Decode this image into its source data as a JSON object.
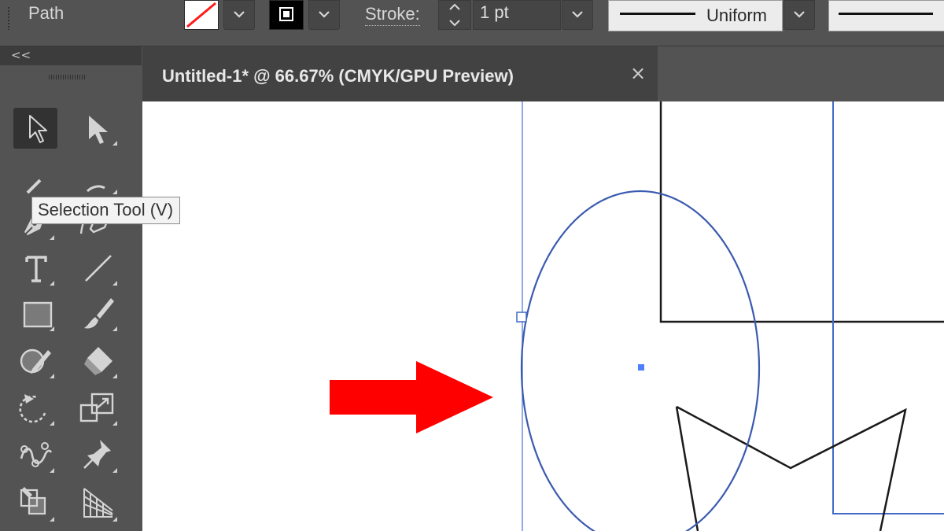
{
  "control_bar": {
    "selection_label": "Path",
    "fill_swatch_icon": "fill-none-swatch-icon",
    "stroke_swatch_icon": "stroke-black-swatch-icon",
    "stroke_label": "Stroke:",
    "stroke_weight": "1 pt",
    "variable_width_profile": "Uniform"
  },
  "toolbar": {
    "collapse_label": "<<",
    "tooltip": "Selection Tool (V)",
    "tools": [
      {
        "name": "selection-tool",
        "icon": "selection-arrow-icon",
        "active": true
      },
      {
        "name": "direct-selection-tool",
        "icon": "direct-selection-arrow-icon"
      },
      {
        "name": "magic-wand-tool",
        "icon": "magic-wand-icon"
      },
      {
        "name": "lasso-tool",
        "icon": "lasso-icon"
      },
      {
        "name": "pen-tool",
        "icon": "pen-icon"
      },
      {
        "name": "curvature-tool",
        "icon": "curvature-pen-icon"
      },
      {
        "name": "type-tool",
        "icon": "type-icon"
      },
      {
        "name": "line-segment-tool",
        "icon": "line-segment-icon"
      },
      {
        "name": "rectangle-tool",
        "icon": "rectangle-icon"
      },
      {
        "name": "paintbrush-tool",
        "icon": "paintbrush-icon"
      },
      {
        "name": "shaper-tool",
        "icon": "shaper-icon"
      },
      {
        "name": "eraser-tool",
        "icon": "eraser-icon"
      },
      {
        "name": "rotate-tool",
        "icon": "rotate-icon"
      },
      {
        "name": "scale-tool",
        "icon": "scale-icon"
      },
      {
        "name": "puppet-warp-tool",
        "icon": "puppet-warp-icon"
      },
      {
        "name": "pin-tool",
        "icon": "pin-icon"
      },
      {
        "name": "shape-builder-tool",
        "icon": "shape-builder-icon"
      },
      {
        "name": "perspective-grid-tool",
        "icon": "perspective-grid-icon"
      }
    ]
  },
  "document": {
    "tab_title": "Untitled-1* @ 66.67% (CMYK/GPU Preview)",
    "close_label": "×"
  },
  "colors": {
    "ui_background": "#535353",
    "tab_background": "#424242",
    "selection_blue": "#4169c8",
    "arrow_red": "#ff0000",
    "artboard": "#ffffff"
  }
}
